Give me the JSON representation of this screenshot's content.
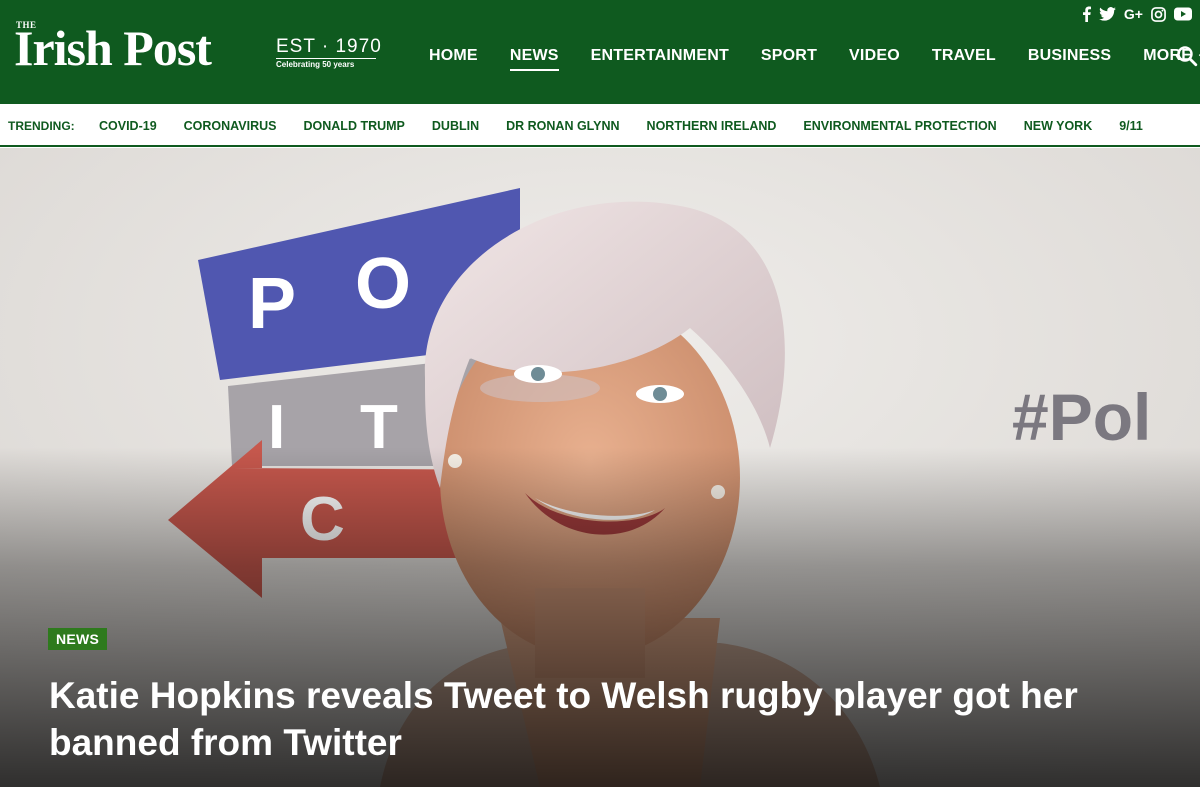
{
  "brand": {
    "the": "THE",
    "name": "Irish Post",
    "est": "EST · 1970",
    "tagline": "Celebrating 50 years"
  },
  "social": [
    "facebook-icon",
    "twitter-icon",
    "google-plus-icon",
    "instagram-icon",
    "youtube-icon"
  ],
  "social_labels": {
    "gplus": "G+"
  },
  "nav": {
    "items": [
      {
        "label": "HOME",
        "active": false
      },
      {
        "label": "NEWS",
        "active": true
      },
      {
        "label": "ENTERTAINMENT",
        "active": false
      },
      {
        "label": "SPORT",
        "active": false
      },
      {
        "label": "VIDEO",
        "active": false
      },
      {
        "label": "TRAVEL",
        "active": false
      },
      {
        "label": "BUSINESS",
        "active": false
      },
      {
        "label": "MORE",
        "active": false
      }
    ]
  },
  "trending": {
    "label": "TRENDING:",
    "tags": [
      "COVID-19",
      "CORONAVIRUS",
      "DONALD TRUMP",
      "DUBLIN",
      "DR RONAN GLYNN",
      "NORTHERN IRELAND",
      "ENVIRONMENTAL PROTECTION",
      "NEW YORK",
      "9/11"
    ]
  },
  "hero": {
    "category": "NEWS",
    "headline": "Katie Hopkins reveals Tweet to Welsh rugby player got her banned from Twitter",
    "backdrop_text": [
      "P",
      "O",
      "I",
      "T",
      "C",
      "#Pol"
    ]
  },
  "colors": {
    "brand_green": "#0f5a1f",
    "badge_green": "#2e7a1d"
  }
}
